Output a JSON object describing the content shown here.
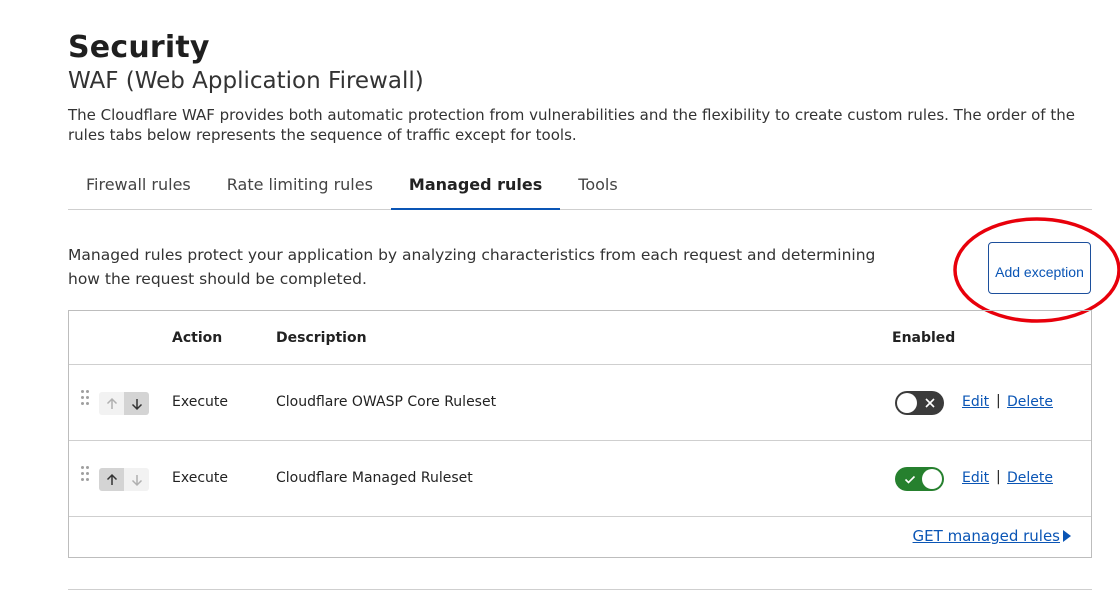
{
  "page": {
    "title": "Security",
    "subtitle": "WAF (Web Application Firewall)",
    "intro": "The Cloudflare WAF provides both automatic protection from vulnerabilities and the flexibility to create custom rules. The order of the rules tabs below represents the sequence of traffic except for tools."
  },
  "tabs": [
    {
      "label": "Firewall rules",
      "active": false
    },
    {
      "label": "Rate limiting rules",
      "active": false
    },
    {
      "label": "Managed rules",
      "active": true
    },
    {
      "label": "Tools",
      "active": false
    }
  ],
  "managed": {
    "description": "Managed rules protect your application by analyzing characteristics from each request and determining how the request should be completed.",
    "add_exception_label": "Add exception",
    "annotation_color": "#e8000b"
  },
  "table": {
    "headers": {
      "action": "Action",
      "description": "Description",
      "enabled": "Enabled"
    },
    "rows": [
      {
        "action": "Execute",
        "description": "Cloudflare OWASP Core Ruleset",
        "enabled": false,
        "edit": "Edit",
        "separator": "|",
        "delete": "Delete"
      },
      {
        "action": "Execute",
        "description": "Cloudflare Managed Ruleset",
        "enabled": true,
        "edit": "Edit",
        "separator": "|",
        "delete": "Delete"
      }
    ],
    "footer_link": "GET managed rules"
  },
  "colors": {
    "link": "#0a55b5",
    "toggle_on": "#26802e",
    "toggle_off": "#3b3b3b"
  }
}
